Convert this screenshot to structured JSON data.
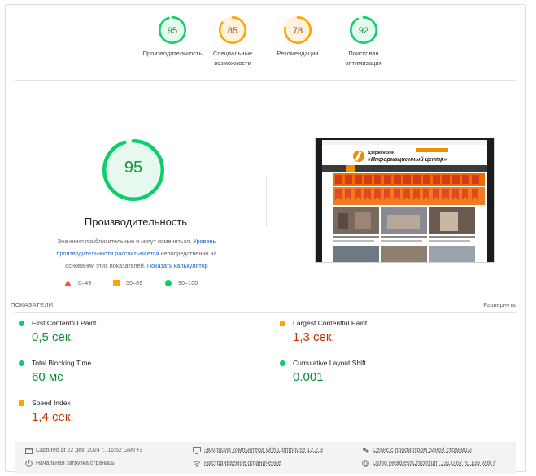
{
  "colors": {
    "pass": "#0cce6b",
    "average": "#ffa400",
    "fail": "#ff4e42"
  },
  "categories": [
    {
      "score": "95",
      "label": "Производительность",
      "status": "pass",
      "fraction": 0.95
    },
    {
      "score": "85",
      "label": "Специальные возможности",
      "status": "average",
      "fraction": 0.85
    },
    {
      "score": "78",
      "label": "Рекомендации",
      "status": "average",
      "fraction": 0.78
    },
    {
      "score": "92",
      "label": "Поисковая оптимизация",
      "status": "pass",
      "fraction": 0.92
    }
  ],
  "performance": {
    "score": "95",
    "fraction": 0.95,
    "title": "Производительность",
    "desc_1": "Значения приблизительные и могут изменяться.",
    "desc_link_1": "Уровень производительности рассчитывается",
    "desc_2": "непосредственно на основании этих показателей.",
    "desc_link_2": "Показать калькулятор"
  },
  "legend": [
    {
      "range": "0–49",
      "shape": "triangle-icon"
    },
    {
      "range": "50–89",
      "shape": "square-icon"
    },
    {
      "range": "90–100",
      "shape": "circle-icon"
    }
  ],
  "metrics_header": {
    "title": "ПОКАЗАТЕЛИ",
    "expand": "Развернуть"
  },
  "metrics": [
    {
      "name": "First Contentful Paint",
      "value": "0,5 сек.",
      "status": "pass"
    },
    {
      "name": "Largest Contentful Paint",
      "value": "1,3 сек.",
      "status": "average"
    },
    {
      "name": "Total Blocking Time",
      "value": "60 мс",
      "status": "pass"
    },
    {
      "name": "Cumulative Layout Shift",
      "value": "0.001",
      "status": "pass"
    },
    {
      "name": "Speed Index",
      "value": "1,4 сек.",
      "status": "average"
    }
  ],
  "footer": {
    "captured": "Captured at 22 дек. 2024 г., 16:52 GMT+3",
    "initial_load": "Начальная загрузка страницы",
    "emulation": "Эмуляция компьютера with Lighthouse 12.2.3",
    "throttling": "Настраиваемое ограничение",
    "session": "Сеанс с просмотром одной страницы",
    "browser": "Using HeadlessChromium 131.0.6778.139 with lr"
  },
  "screenshot": {
    "site_line1": "Дзержинский",
    "site_line2": "«Информационный центр»"
  }
}
